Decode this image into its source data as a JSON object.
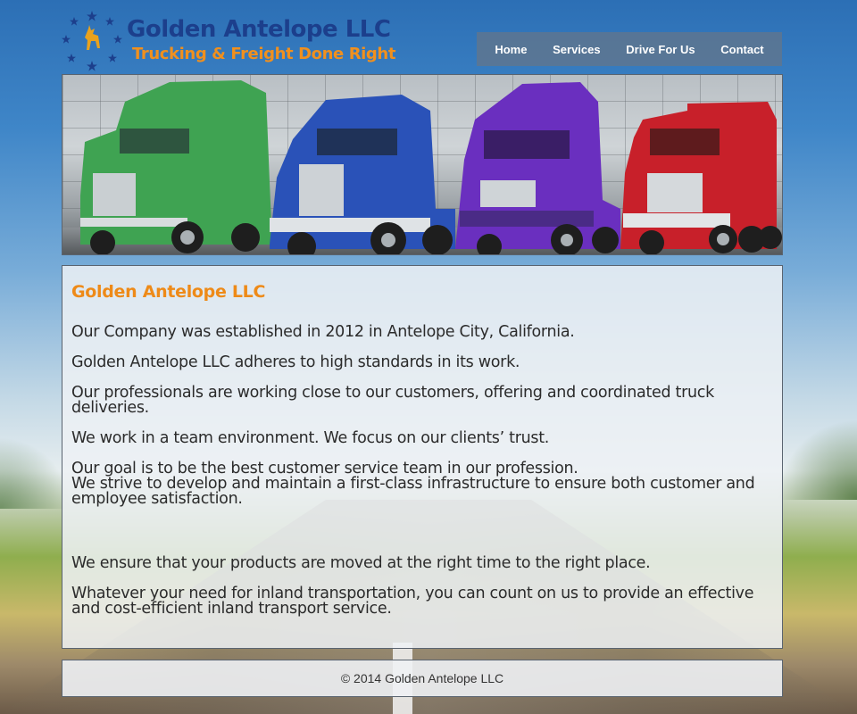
{
  "header": {
    "company_name": "Golden Antelope LLC",
    "tagline": "Trucking & Freight Done Right",
    "logo_icon": "antelope-star-ring-icon"
  },
  "nav": {
    "items": [
      {
        "label": "Home"
      },
      {
        "label": "Services"
      },
      {
        "label": "Drive For Us"
      },
      {
        "label": "Contact"
      }
    ]
  },
  "banner": {
    "trucks": [
      {
        "color": "#3fa352"
      },
      {
        "color": "#2a52b8"
      },
      {
        "color": "#6a2fbf"
      },
      {
        "color": "#c8202a"
      }
    ]
  },
  "content": {
    "heading": "Golden Antelope LLC",
    "paragraphs": [
      "Our Company was established in 2012 in Antelope City, California.",
      "Golden Antelope LLC adheres to high standards in its work.",
      "Our professionals are working close to our customers, offering and coordinated truck deliveries.",
      "We work in a team environment. We focus on our clients’ trust.",
      "Our goal is to be the best customer service team in our profession.",
      "We strive to develop and maintain a first-class infrastructure to ensure both customer and employee satisfaction.",
      "We ensure that your products are moved at the right time to the right place.",
      "Whatever your need for inland transportation, you can count on us to provide an effective and cost-efficient inland transport service."
    ]
  },
  "footer": {
    "copyright": "© 2014 Golden Antelope LLC"
  },
  "colors": {
    "title_blue": "#1c3f8c",
    "accent_orange": "#ee8a18",
    "nav_bg": "#64768a"
  }
}
